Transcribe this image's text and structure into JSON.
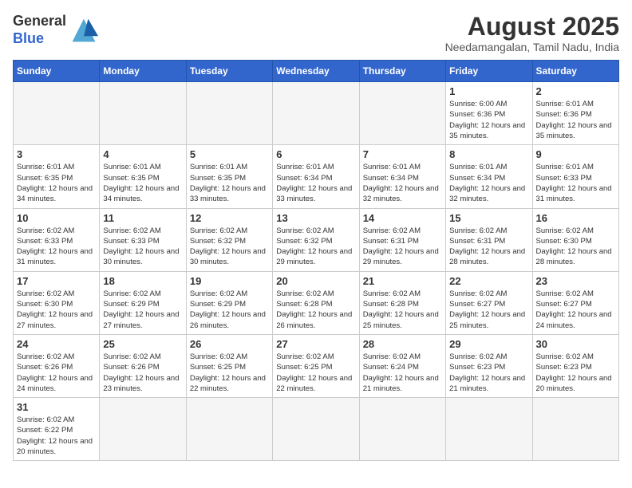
{
  "header": {
    "logo_general": "General",
    "logo_blue": "Blue",
    "month_title": "August 2025",
    "location": "Needamangalan, Tamil Nadu, India"
  },
  "weekdays": [
    "Sunday",
    "Monday",
    "Tuesday",
    "Wednesday",
    "Thursday",
    "Friday",
    "Saturday"
  ],
  "weeks": [
    [
      {
        "day": "",
        "info": ""
      },
      {
        "day": "",
        "info": ""
      },
      {
        "day": "",
        "info": ""
      },
      {
        "day": "",
        "info": ""
      },
      {
        "day": "",
        "info": ""
      },
      {
        "day": "1",
        "info": "Sunrise: 6:00 AM\nSunset: 6:36 PM\nDaylight: 12 hours and 35 minutes."
      },
      {
        "day": "2",
        "info": "Sunrise: 6:01 AM\nSunset: 6:36 PM\nDaylight: 12 hours and 35 minutes."
      }
    ],
    [
      {
        "day": "3",
        "info": "Sunrise: 6:01 AM\nSunset: 6:35 PM\nDaylight: 12 hours and 34 minutes."
      },
      {
        "day": "4",
        "info": "Sunrise: 6:01 AM\nSunset: 6:35 PM\nDaylight: 12 hours and 34 minutes."
      },
      {
        "day": "5",
        "info": "Sunrise: 6:01 AM\nSunset: 6:35 PM\nDaylight: 12 hours and 33 minutes."
      },
      {
        "day": "6",
        "info": "Sunrise: 6:01 AM\nSunset: 6:34 PM\nDaylight: 12 hours and 33 minutes."
      },
      {
        "day": "7",
        "info": "Sunrise: 6:01 AM\nSunset: 6:34 PM\nDaylight: 12 hours and 32 minutes."
      },
      {
        "day": "8",
        "info": "Sunrise: 6:01 AM\nSunset: 6:34 PM\nDaylight: 12 hours and 32 minutes."
      },
      {
        "day": "9",
        "info": "Sunrise: 6:01 AM\nSunset: 6:33 PM\nDaylight: 12 hours and 31 minutes."
      }
    ],
    [
      {
        "day": "10",
        "info": "Sunrise: 6:02 AM\nSunset: 6:33 PM\nDaylight: 12 hours and 31 minutes."
      },
      {
        "day": "11",
        "info": "Sunrise: 6:02 AM\nSunset: 6:33 PM\nDaylight: 12 hours and 30 minutes."
      },
      {
        "day": "12",
        "info": "Sunrise: 6:02 AM\nSunset: 6:32 PM\nDaylight: 12 hours and 30 minutes."
      },
      {
        "day": "13",
        "info": "Sunrise: 6:02 AM\nSunset: 6:32 PM\nDaylight: 12 hours and 29 minutes."
      },
      {
        "day": "14",
        "info": "Sunrise: 6:02 AM\nSunset: 6:31 PM\nDaylight: 12 hours and 29 minutes."
      },
      {
        "day": "15",
        "info": "Sunrise: 6:02 AM\nSunset: 6:31 PM\nDaylight: 12 hours and 28 minutes."
      },
      {
        "day": "16",
        "info": "Sunrise: 6:02 AM\nSunset: 6:30 PM\nDaylight: 12 hours and 28 minutes."
      }
    ],
    [
      {
        "day": "17",
        "info": "Sunrise: 6:02 AM\nSunset: 6:30 PM\nDaylight: 12 hours and 27 minutes."
      },
      {
        "day": "18",
        "info": "Sunrise: 6:02 AM\nSunset: 6:29 PM\nDaylight: 12 hours and 27 minutes."
      },
      {
        "day": "19",
        "info": "Sunrise: 6:02 AM\nSunset: 6:29 PM\nDaylight: 12 hours and 26 minutes."
      },
      {
        "day": "20",
        "info": "Sunrise: 6:02 AM\nSunset: 6:28 PM\nDaylight: 12 hours and 26 minutes."
      },
      {
        "day": "21",
        "info": "Sunrise: 6:02 AM\nSunset: 6:28 PM\nDaylight: 12 hours and 25 minutes."
      },
      {
        "day": "22",
        "info": "Sunrise: 6:02 AM\nSunset: 6:27 PM\nDaylight: 12 hours and 25 minutes."
      },
      {
        "day": "23",
        "info": "Sunrise: 6:02 AM\nSunset: 6:27 PM\nDaylight: 12 hours and 24 minutes."
      }
    ],
    [
      {
        "day": "24",
        "info": "Sunrise: 6:02 AM\nSunset: 6:26 PM\nDaylight: 12 hours and 24 minutes."
      },
      {
        "day": "25",
        "info": "Sunrise: 6:02 AM\nSunset: 6:26 PM\nDaylight: 12 hours and 23 minutes."
      },
      {
        "day": "26",
        "info": "Sunrise: 6:02 AM\nSunset: 6:25 PM\nDaylight: 12 hours and 22 minutes."
      },
      {
        "day": "27",
        "info": "Sunrise: 6:02 AM\nSunset: 6:25 PM\nDaylight: 12 hours and 22 minutes."
      },
      {
        "day": "28",
        "info": "Sunrise: 6:02 AM\nSunset: 6:24 PM\nDaylight: 12 hours and 21 minutes."
      },
      {
        "day": "29",
        "info": "Sunrise: 6:02 AM\nSunset: 6:23 PM\nDaylight: 12 hours and 21 minutes."
      },
      {
        "day": "30",
        "info": "Sunrise: 6:02 AM\nSunset: 6:23 PM\nDaylight: 12 hours and 20 minutes."
      }
    ],
    [
      {
        "day": "31",
        "info": "Sunrise: 6:02 AM\nSunset: 6:22 PM\nDaylight: 12 hours and 20 minutes."
      },
      {
        "day": "",
        "info": ""
      },
      {
        "day": "",
        "info": ""
      },
      {
        "day": "",
        "info": ""
      },
      {
        "day": "",
        "info": ""
      },
      {
        "day": "",
        "info": ""
      },
      {
        "day": "",
        "info": ""
      }
    ]
  ]
}
